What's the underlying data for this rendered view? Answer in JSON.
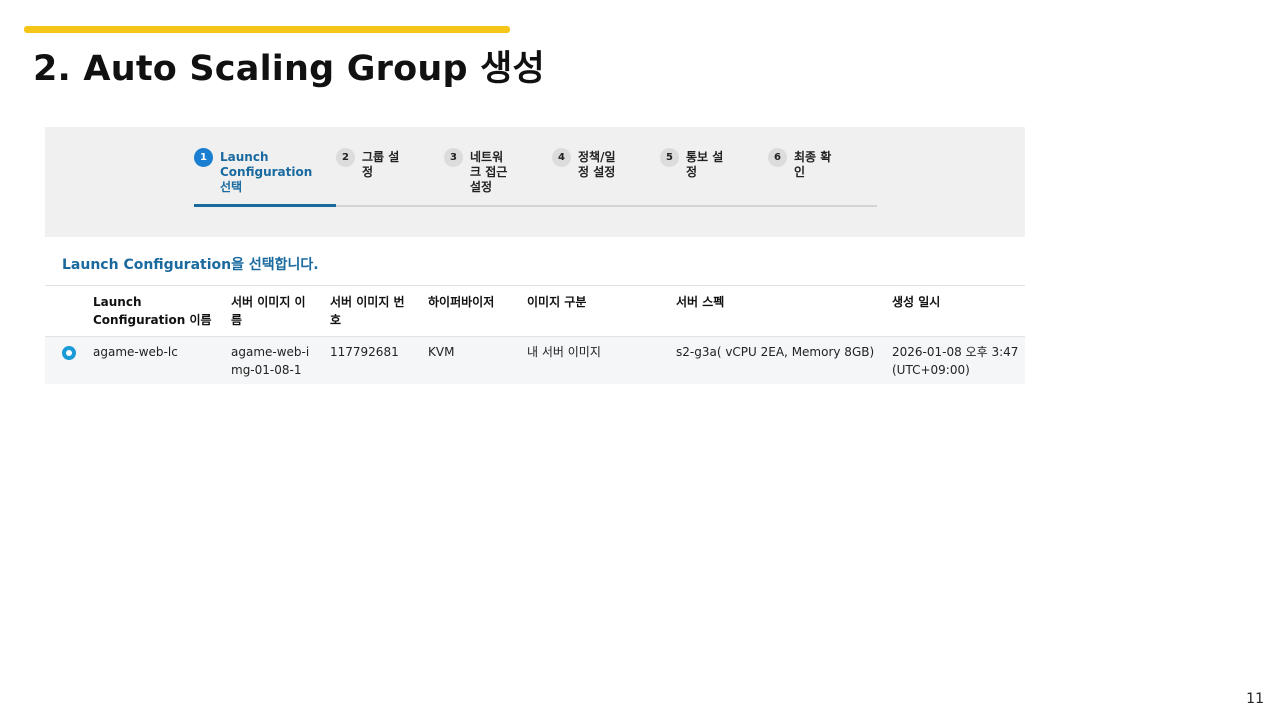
{
  "slide": {
    "title": "2. Auto Scaling Group 생성",
    "page_number": "11",
    "accent_color": "#f5c518"
  },
  "wizard": {
    "steps": [
      {
        "number": "1",
        "label": "Launch\nConfiguration\n선택",
        "active": true
      },
      {
        "number": "2",
        "label": "그룹 설\n정",
        "active": false
      },
      {
        "number": "3",
        "label": "네트워\n크 접근\n설정",
        "active": false
      },
      {
        "number": "4",
        "label": "정책/일\n정 설정",
        "active": false
      },
      {
        "number": "5",
        "label": "통보 설\n정",
        "active": false
      },
      {
        "number": "6",
        "label": "최종 확\n인",
        "active": false
      }
    ],
    "active_color": "#1a6a9f"
  },
  "instruction": "Launch Configuration을 선택합니다.",
  "table": {
    "headers": [
      "",
      "Launch\nConfiguration 이름",
      "서버 이미지 이\n름",
      "서버 이미지 번\n호",
      "하이퍼바이저",
      "이미지 구분",
      "서버 스펙",
      "생성 일시"
    ],
    "rows": [
      {
        "selected": true,
        "name": "agame-web-lc",
        "image_name": "agame-web-i\nmg-01-08-1",
        "image_number": "117792681",
        "hypervisor": "KVM",
        "image_type": "내 서버 이미지",
        "server_spec": "s2-g3a( vCPU 2EA, Memory 8GB)",
        "created_at": "2026-01-08 오후 3:47\n(UTC+09:00)"
      }
    ],
    "radio_color": "#1a9ad6"
  }
}
